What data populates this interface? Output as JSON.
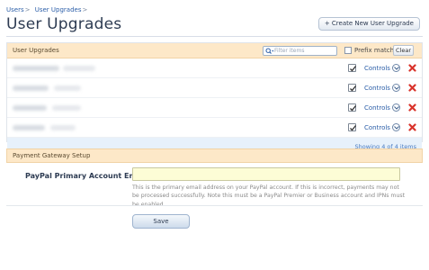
{
  "breadcrumb": {
    "items": [
      "Users",
      "User Upgrades"
    ],
    "separator": ">"
  },
  "page": {
    "title": "User Upgrades",
    "create_button": "+ Create New User Upgrade"
  },
  "upgrades": {
    "header": "User Upgrades",
    "filter_placeholder": "Filter items",
    "prefix_match_label": "Prefix match",
    "clear_label": "Clear",
    "rows": [
      {
        "enabled": true,
        "controls_label": "Controls"
      },
      {
        "enabled": true,
        "controls_label": "Controls"
      },
      {
        "enabled": true,
        "controls_label": "Controls"
      },
      {
        "enabled": true,
        "controls_label": "Controls"
      }
    ],
    "footer": "Showing 4 of 4 items"
  },
  "payment": {
    "header": "Payment Gateway Setup",
    "field_label": "PayPal Primary Account Email",
    "field_value": "",
    "hint": "This is the primary email address on your PayPal account. If this is incorrect, payments may not be processed successfully. Note this must be a PayPal Premier or Business account and IPNs must be enabled.",
    "save_label": "Save"
  },
  "colors": {
    "section_header_bg": "#fde8c8",
    "link": "#2b5ea8",
    "footer_bg": "#e7f1fb",
    "delete_icon": "#d9332b",
    "input_highlight": "#fdfdd6"
  }
}
